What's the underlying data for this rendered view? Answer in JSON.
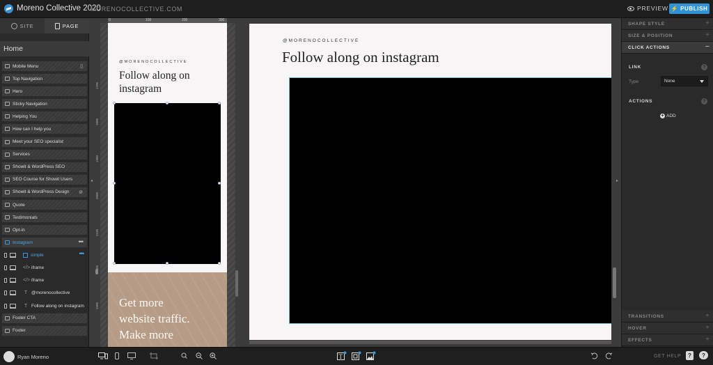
{
  "topbar": {
    "app_title": "Moreno Collective 2020",
    "site_url": "MORENOCOLLECTIVE.COM",
    "preview_label": "PREVIEW",
    "publish_label": "PUBLISH",
    "accent": "#2f93d6"
  },
  "sidebar": {
    "tabs": [
      {
        "label": "SITE",
        "icon": "globe-icon"
      },
      {
        "label": "PAGE",
        "icon": "page-icon"
      }
    ],
    "page_title": "Home",
    "sections": [
      {
        "label": "Mobile Menu",
        "right": "▯"
      },
      {
        "label": "Top Navigation"
      },
      {
        "label": "Hero"
      },
      {
        "label": "Sticky Navigation"
      },
      {
        "label": "Helping You"
      },
      {
        "label": "How can I help you"
      },
      {
        "label": "Meet your SEO specialist"
      },
      {
        "label": "Services"
      },
      {
        "label": "Showit & WordPress SEO"
      },
      {
        "label": "SEO Course for Showit Users"
      },
      {
        "label": "Showit & WordPress Design",
        "right": "⊘"
      },
      {
        "label": "Quote"
      },
      {
        "label": "Testimonials"
      },
      {
        "label": "Opt-in"
      },
      {
        "label": "Instagram",
        "active": true,
        "right": "•••"
      }
    ],
    "elements": [
      {
        "label": "simple",
        "icon": "box-icon",
        "active": true
      },
      {
        "label": "iframe",
        "icon": "code-icon"
      },
      {
        "label": "iframe",
        "icon": "code-icon"
      },
      {
        "label": "@morenocollective",
        "icon": "text-icon"
      },
      {
        "label": "Follow along on instagram",
        "icon": "text-icon"
      }
    ],
    "footer_sections": [
      {
        "label": "Footer CTA"
      },
      {
        "label": "Footer"
      }
    ]
  },
  "canvas": {
    "ruler_labels": [
      "0",
      "100",
      "200",
      "300"
    ],
    "side_ruler_labels": [
      "1700",
      "1800",
      "1900",
      "2000",
      "2100",
      "2200",
      "2300"
    ],
    "mobile": {
      "handle": "@MORENOCOLLECTIVE",
      "heading_line1": "Follow along on",
      "heading_line2": "instagram",
      "cta_line1": "Get more",
      "cta_line2": "website traffic.",
      "cta_line3": "Make more"
    },
    "desktop": {
      "handle": "@MORENOCOLLECTIVE",
      "heading": "Follow along on instagram"
    },
    "colors": {
      "canvas_bg": "#f7f5f5",
      "embed": "#000000",
      "cta_bg": "#b69c86"
    }
  },
  "right_panel": {
    "top_rows": [
      "SHAPE STYLE",
      "SIZE & POSITION",
      "CLICK ACTIONS"
    ],
    "link_heading": "LINK",
    "type_label": "Type",
    "type_value": "None",
    "actions_heading": "ACTIONS",
    "add_label": "ADD",
    "bottom_rows": [
      "TRANSITIONS",
      "HOVER",
      "EFFECTS"
    ]
  },
  "bottombar": {
    "user_name": "Ryan Moreno",
    "get_help": "GET HELP",
    "help_box1": "?",
    "help_box2": "?"
  }
}
